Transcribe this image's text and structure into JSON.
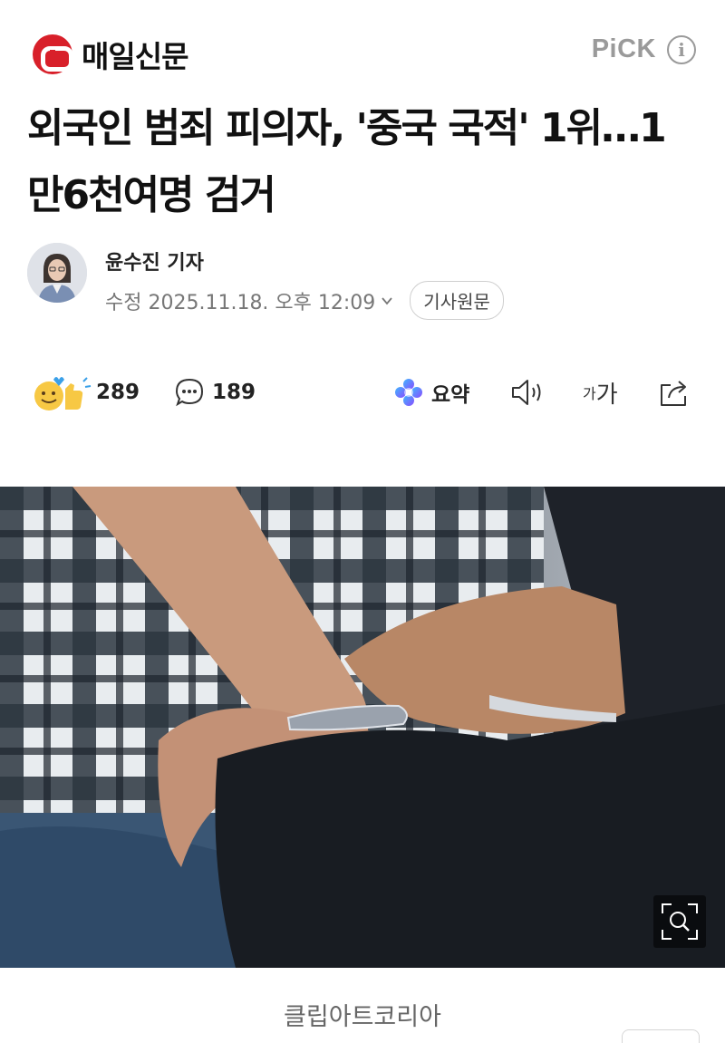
{
  "brand": {
    "name": "매일신문",
    "logo_color": "#d8202a"
  },
  "pick": {
    "label": "PiCK",
    "info_icon": "info-icon"
  },
  "article": {
    "headline": "외국인 범죄 피의자, '중국 국적' 1위…1만6천여명 검거",
    "reporter": "윤수진 기자",
    "date_label": "수정 2025.11.18. 오후 12:09",
    "original_button": "기사원문"
  },
  "toolbar": {
    "reactions_count": "289",
    "comments_count": "189",
    "summary_label": "요약",
    "font_size_label_small": "가",
    "font_size_label_large": "가"
  },
  "image": {
    "caption": "클립아트코리아"
  },
  "colors": {
    "accent_red": "#d8202a",
    "muted_gray": "#9a9a9a",
    "text_dark": "#111111"
  }
}
